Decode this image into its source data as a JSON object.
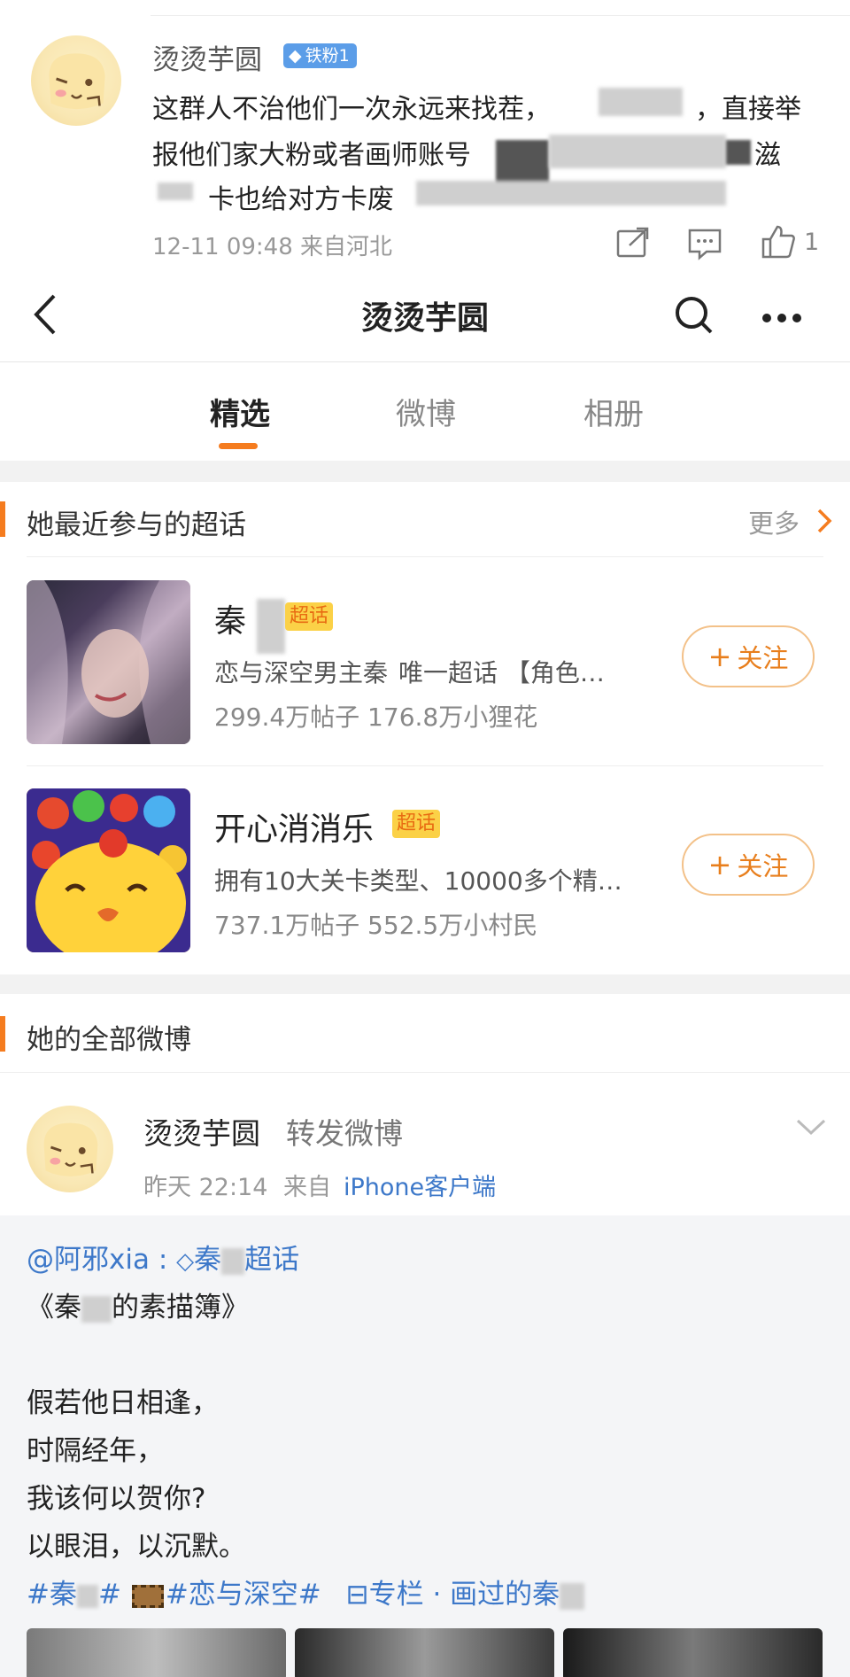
{
  "comment": {
    "username": "烫烫芋圆",
    "badge": "铁粉1",
    "lines": [
      "这群人不治他们一次永远来找茬，",
      "报他们家大粉或者画师账号",
      "卡也给对方卡废"
    ],
    "line_segments": {
      "l1_end": "，直接举",
      "l2_end": "滋"
    },
    "meta": "12-11 09:48 来自河北",
    "like_count": "1"
  },
  "header": {
    "title": "烫烫芋圆"
  },
  "tabs": [
    {
      "label": "精选",
      "active": true
    },
    {
      "label": "微博",
      "active": false
    },
    {
      "label": "相册",
      "active": false
    }
  ],
  "topics_section": {
    "title": "她最近参与的超话",
    "more": "更多",
    "items": [
      {
        "name": "秦",
        "tag": "超话",
        "desc": "恋与深空男主秦",
        "desc_tail": "唯一超话 【角色…",
        "stats": "299.4万帖子 176.8万小狸花",
        "follow": "关注"
      },
      {
        "name": "开心消消乐",
        "tag": "超话",
        "desc": "拥有10大关卡类型、10000多个精…",
        "desc_tail": "",
        "stats": "737.1万帖子 552.5万小村民",
        "follow": "关注"
      }
    ]
  },
  "posts_section": {
    "title": "她的全部微博",
    "post": {
      "username": "烫烫芋圆",
      "type": "转发微博",
      "time": "昨天 22:14",
      "source_prefix": "来自",
      "source": "iPhone客户端",
      "repost": {
        "mention": "@阿邪xia",
        "colon": " :",
        "topic_prefix": "秦",
        "topic_suffix": "超话",
        "title_open": "《秦",
        "title_close": "的素描簿》",
        "poem": [
          "假若他日相逢，",
          "时隔经年，",
          "我该何以贺你?",
          "以眼泪，以沉默。"
        ],
        "tags": [
          "#秦",
          "#",
          "#恋与深空#",
          "专栏 · 画过的秦"
        ]
      }
    }
  },
  "colors": {
    "accent": "#f57c1f",
    "link": "#3d78c9",
    "badge": "#5b9de8",
    "chaohua": "#fbd147"
  }
}
